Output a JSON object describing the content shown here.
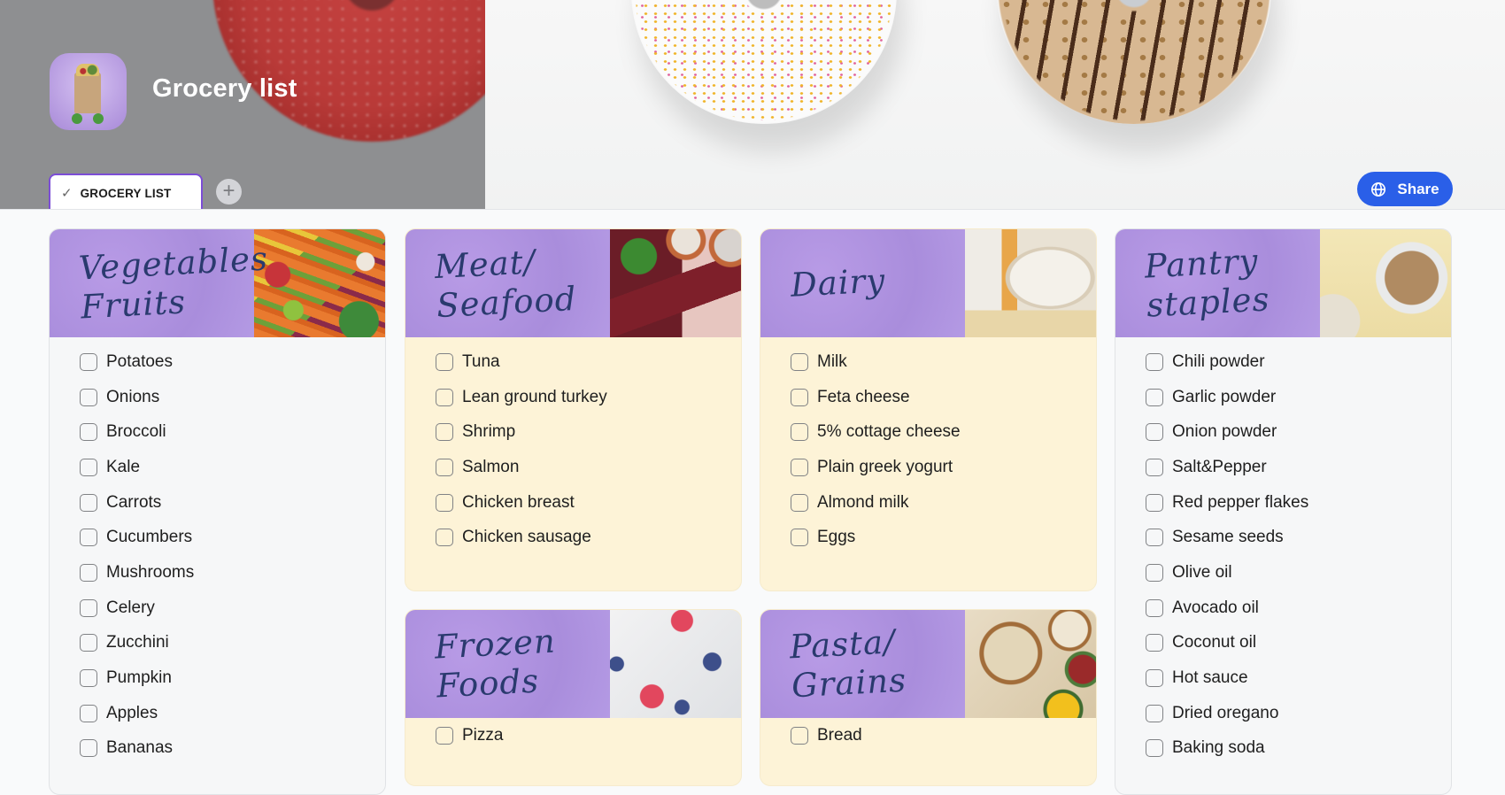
{
  "header": {
    "title": "Grocery list",
    "app_icon": "grocery-bag-icon",
    "share_label": "Share",
    "share_icon": "globe-icon"
  },
  "tabs": [
    {
      "label": "GROCERY LIST",
      "icon": "check-icon",
      "active": true
    }
  ],
  "add_tab_icon": "plus-icon",
  "colors": {
    "accent_purple": "#7c4dd6",
    "share_blue": "#2a5fe8",
    "header_purple": "#ae93e0",
    "title_navy": "#2a3a6e",
    "cream_card": "#fdf3d7",
    "gray_card": "#f6f7f8"
  },
  "lists": [
    {
      "title": "Vegetables\nFruits",
      "image": "vegetables-photo",
      "items": [
        "Potatoes",
        "Onions",
        "Broccoli",
        "Kale",
        "Carrots",
        "Cucumbers",
        "Mushrooms",
        "Celery",
        "Zucchini",
        "Pumpkin",
        "Apples",
        "Bananas"
      ]
    },
    {
      "title": "Meat/\nSeafood",
      "image": "meat-photo",
      "items": [
        "Tuna",
        "Lean ground turkey",
        "Shrimp",
        "Salmon",
        "Chicken breast",
        "Chicken sausage"
      ]
    },
    {
      "title": "Dairy",
      "image": "dairy-photo",
      "items": [
        "Milk",
        "Feta cheese",
        "5% cottage cheese",
        "Plain greek yogurt",
        "Almond milk",
        "Eggs"
      ]
    },
    {
      "title": "Pantry\nstaples",
      "image": "pantry-photo",
      "items": [
        "Chili powder",
        "Garlic powder",
        "Onion powder",
        "Salt&Pepper",
        "Red pepper flakes",
        "Sesame seeds",
        "Olive oil",
        "Avocado oil",
        "Coconut oil",
        "Hot sauce",
        "Dried oregano",
        "Baking soda"
      ]
    },
    {
      "title": "Frozen\nFoods",
      "image": "frozen-berries-photo",
      "items": [
        "Pizza"
      ]
    },
    {
      "title": "Pasta/\nGrains",
      "image": "grains-photo",
      "items": [
        "Bread"
      ]
    }
  ]
}
